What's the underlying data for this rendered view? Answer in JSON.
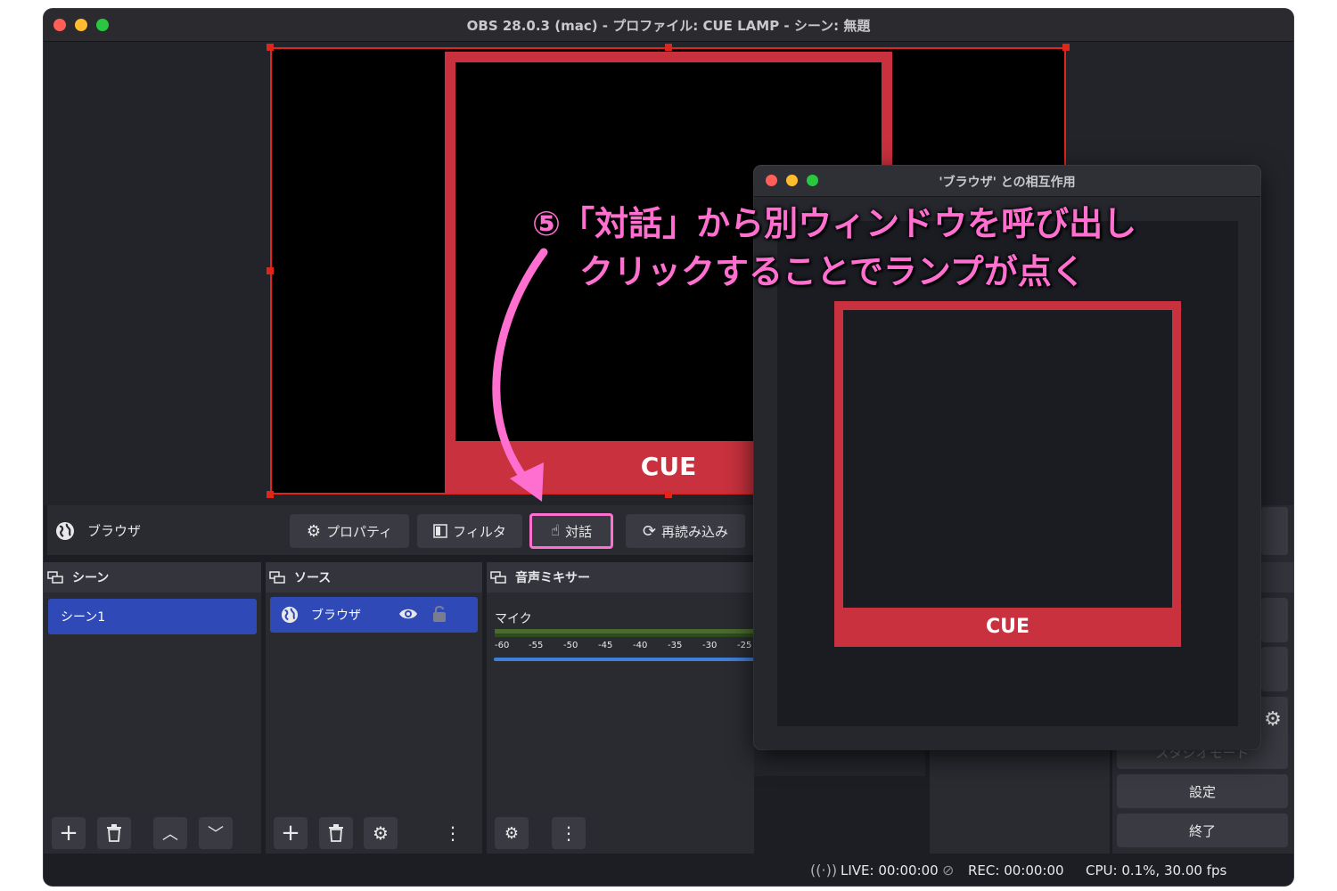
{
  "window": {
    "title": "OBS 28.0.3 (mac) - プロファイル: CUE LAMP - シーン: 無題"
  },
  "preview": {
    "lamp_label": "CUE"
  },
  "context_bar": {
    "source_name": "ブラウザ",
    "properties_label": "プロパティ",
    "filters_label": "フィルタ",
    "interact_label": "対話",
    "reload_label": "再読み込み"
  },
  "docks": {
    "scenes": {
      "title": "シーン",
      "items": [
        "シーン1"
      ]
    },
    "sources": {
      "title": "ソース",
      "items": [
        {
          "name": "ブラウザ"
        }
      ]
    },
    "mixer": {
      "title": "音声ミキサー",
      "channel": "マイク",
      "ticks": [
        "-60",
        "-55",
        "-50",
        "-45",
        "-40",
        "-35",
        "-30",
        "-25"
      ]
    },
    "controls": {
      "studio_mode": "スタジオモード",
      "settings": "設定",
      "exit": "終了"
    }
  },
  "status": {
    "live": "LIVE: 00:00:00",
    "rec": "REC: 00:00:00",
    "cpu": "CPU: 0.1%, 30.00 fps"
  },
  "popup": {
    "title": "'ブラウザ' との相互作用",
    "lamp_label": "CUE"
  },
  "annotation": {
    "line1": "⑤「対話」から別ウィンドウを呼び出し",
    "line2": "クリックすることでランプが点く"
  },
  "colors": {
    "accent": "#2f49b7",
    "lamp": "#c8313d",
    "annotation": "#ff6fcf",
    "selection": "#e0251c"
  }
}
